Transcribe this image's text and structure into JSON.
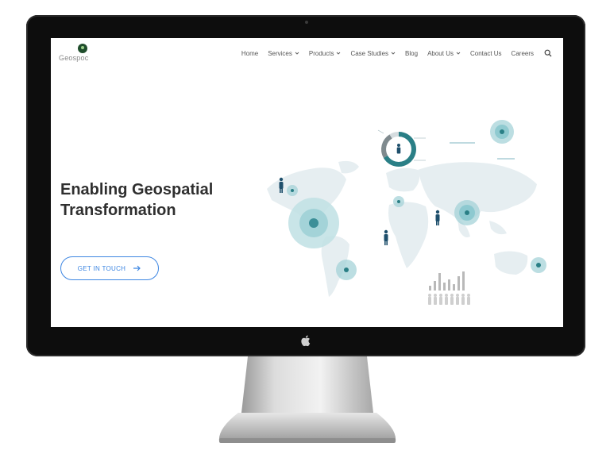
{
  "brand": {
    "logo_text": "Geospoc"
  },
  "nav": {
    "items": [
      {
        "label": "Home",
        "dropdown": false
      },
      {
        "label": "Services",
        "dropdown": true
      },
      {
        "label": "Products",
        "dropdown": true
      },
      {
        "label": "Case Studies",
        "dropdown": true
      },
      {
        "label": "Blog",
        "dropdown": false
      },
      {
        "label": "About Us",
        "dropdown": true
      },
      {
        "label": "Contact Us",
        "dropdown": false
      },
      {
        "label": "Careers",
        "dropdown": false
      }
    ],
    "search_icon": "search-icon"
  },
  "hero": {
    "title_line1": "Enabling Geospatial",
    "title_line2": "Transformation",
    "cta_label": "GET IN TOUCH",
    "cta_icon": "arrow-right-icon"
  },
  "colors": {
    "accent": "#3d86e2",
    "teal": "#2a7f86",
    "title": "#2f2f2f",
    "bezel": "#0d0d0d"
  }
}
